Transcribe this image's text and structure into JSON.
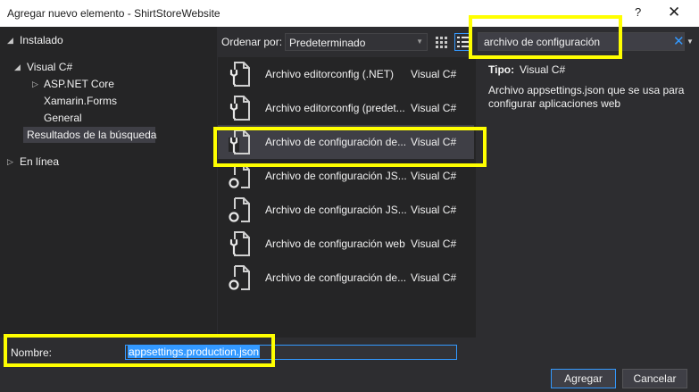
{
  "window": {
    "title": "Agregar nuevo elemento - ShirtStoreWebsite",
    "help": "?",
    "close": "✕"
  },
  "tree": {
    "installed": "Instalado",
    "visual_csharp": "Visual C#",
    "aspnet": "ASP.NET Core",
    "xamarin": "Xamarin.Forms",
    "general": "General",
    "results": "Resultados de la búsqueda",
    "online": "En línea"
  },
  "toolbar": {
    "sort_label": "Ordenar por:",
    "sort_value": "Predeterminado"
  },
  "search": {
    "value": "archivo de configuración",
    "clear": "✕"
  },
  "items": [
    {
      "name": "Archivo editorconfig (.NET)",
      "type": "Visual C#",
      "icon": "wrench-file-icon"
    },
    {
      "name": "Archivo editorconfig (predet...",
      "type": "Visual C#",
      "icon": "wrench-file-icon"
    },
    {
      "name": "Archivo de configuración de...",
      "type": "Visual C#",
      "icon": "wrench-file-icon"
    },
    {
      "name": "Archivo de configuración JS...",
      "type": "Visual C#",
      "icon": "js-file-icon"
    },
    {
      "name": "Archivo de configuración JS...",
      "type": "Visual C#",
      "icon": "js-file-icon"
    },
    {
      "name": "Archivo de configuración web",
      "type": "Visual C#",
      "icon": "wrench-file-icon"
    },
    {
      "name": "Archivo de configuración de...",
      "type": "Visual C#",
      "icon": "js-file-icon"
    }
  ],
  "selected_index": 2,
  "details": {
    "type_label": "Tipo:",
    "type_value": "Visual C#",
    "description": "Archivo appsettings.json que se usa para configurar aplicaciones web"
  },
  "bottom": {
    "name_label": "Nombre:",
    "name_value": "appsettings.production.json",
    "add_button": "Agregar",
    "cancel_button": "Cancelar"
  },
  "colors": {
    "accent": "#3399ff",
    "highlight": "#ffff00",
    "background": "#2d2d30"
  }
}
